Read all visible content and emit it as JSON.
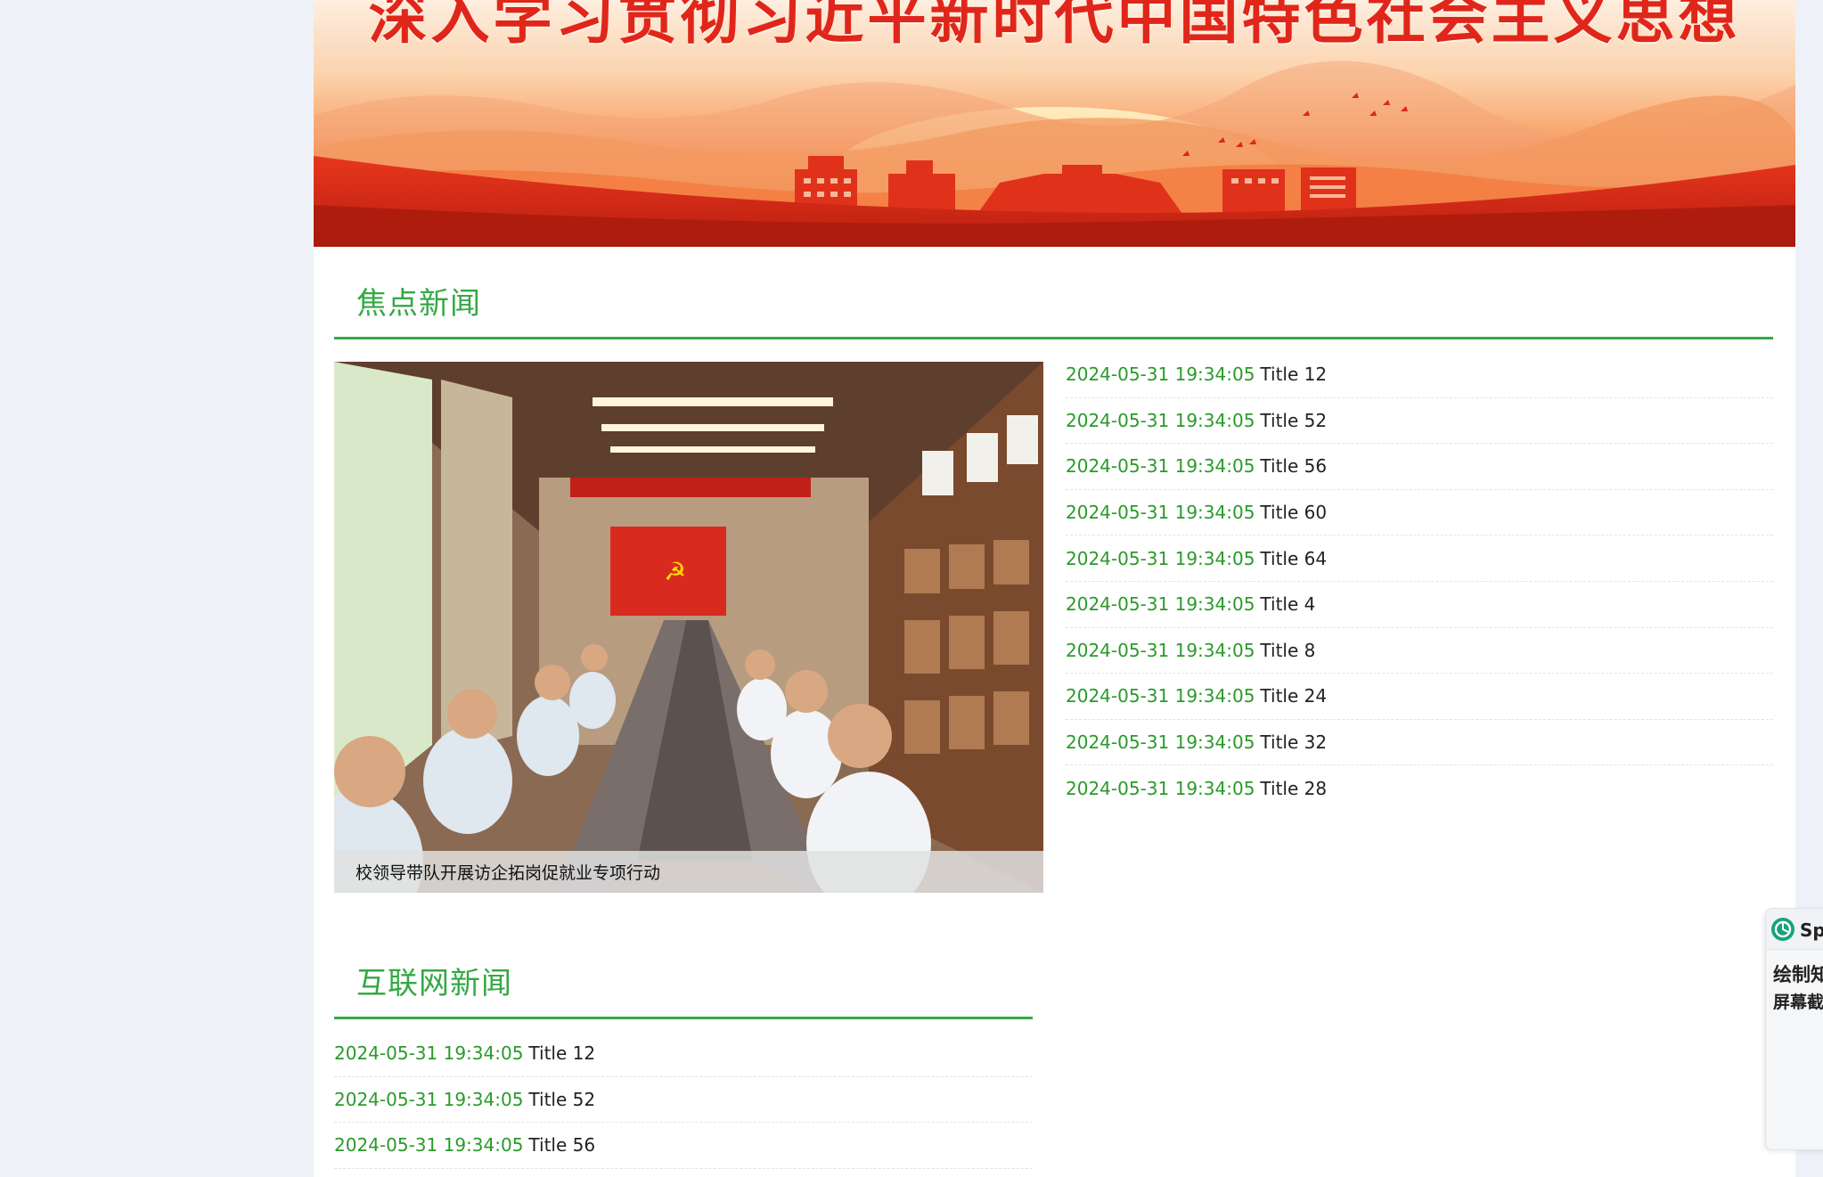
{
  "banner": {
    "title": "深入学习贯彻习近平新时代中国特色社会主义思想"
  },
  "focus_news": {
    "heading": "焦点新闻",
    "photo_caption": "校领导带队开展访企拓岗促就业专项行动",
    "items": [
      {
        "date": "2024-05-31 19:34:05",
        "title": "Title 12"
      },
      {
        "date": "2024-05-31 19:34:05",
        "title": "Title 52"
      },
      {
        "date": "2024-05-31 19:34:05",
        "title": "Title 56"
      },
      {
        "date": "2024-05-31 19:34:05",
        "title": "Title 60"
      },
      {
        "date": "2024-05-31 19:34:05",
        "title": "Title 64"
      },
      {
        "date": "2024-05-31 19:34:05",
        "title": "Title 4"
      },
      {
        "date": "2024-05-31 19:34:05",
        "title": "Title 8"
      },
      {
        "date": "2024-05-31 19:34:05",
        "title": "Title 24"
      },
      {
        "date": "2024-05-31 19:34:05",
        "title": "Title 32"
      },
      {
        "date": "2024-05-31 19:34:05",
        "title": "Title 28"
      }
    ]
  },
  "internet_news": {
    "heading": "互联网新闻",
    "items": [
      {
        "date": "2024-05-31 19:34:05",
        "title": "Title 12"
      },
      {
        "date": "2024-05-31 19:34:05",
        "title": "Title 52"
      },
      {
        "date": "2024-05-31 19:34:05",
        "title": "Title 56"
      }
    ]
  },
  "side_widget": {
    "name": "Spe",
    "line1": "绘制知",
    "line2": "屏幕截"
  },
  "colors": {
    "accent_green": "#35a845",
    "date_green": "#2a9a2a",
    "banner_red": "#e0261a",
    "page_background": "#eef2f8"
  }
}
